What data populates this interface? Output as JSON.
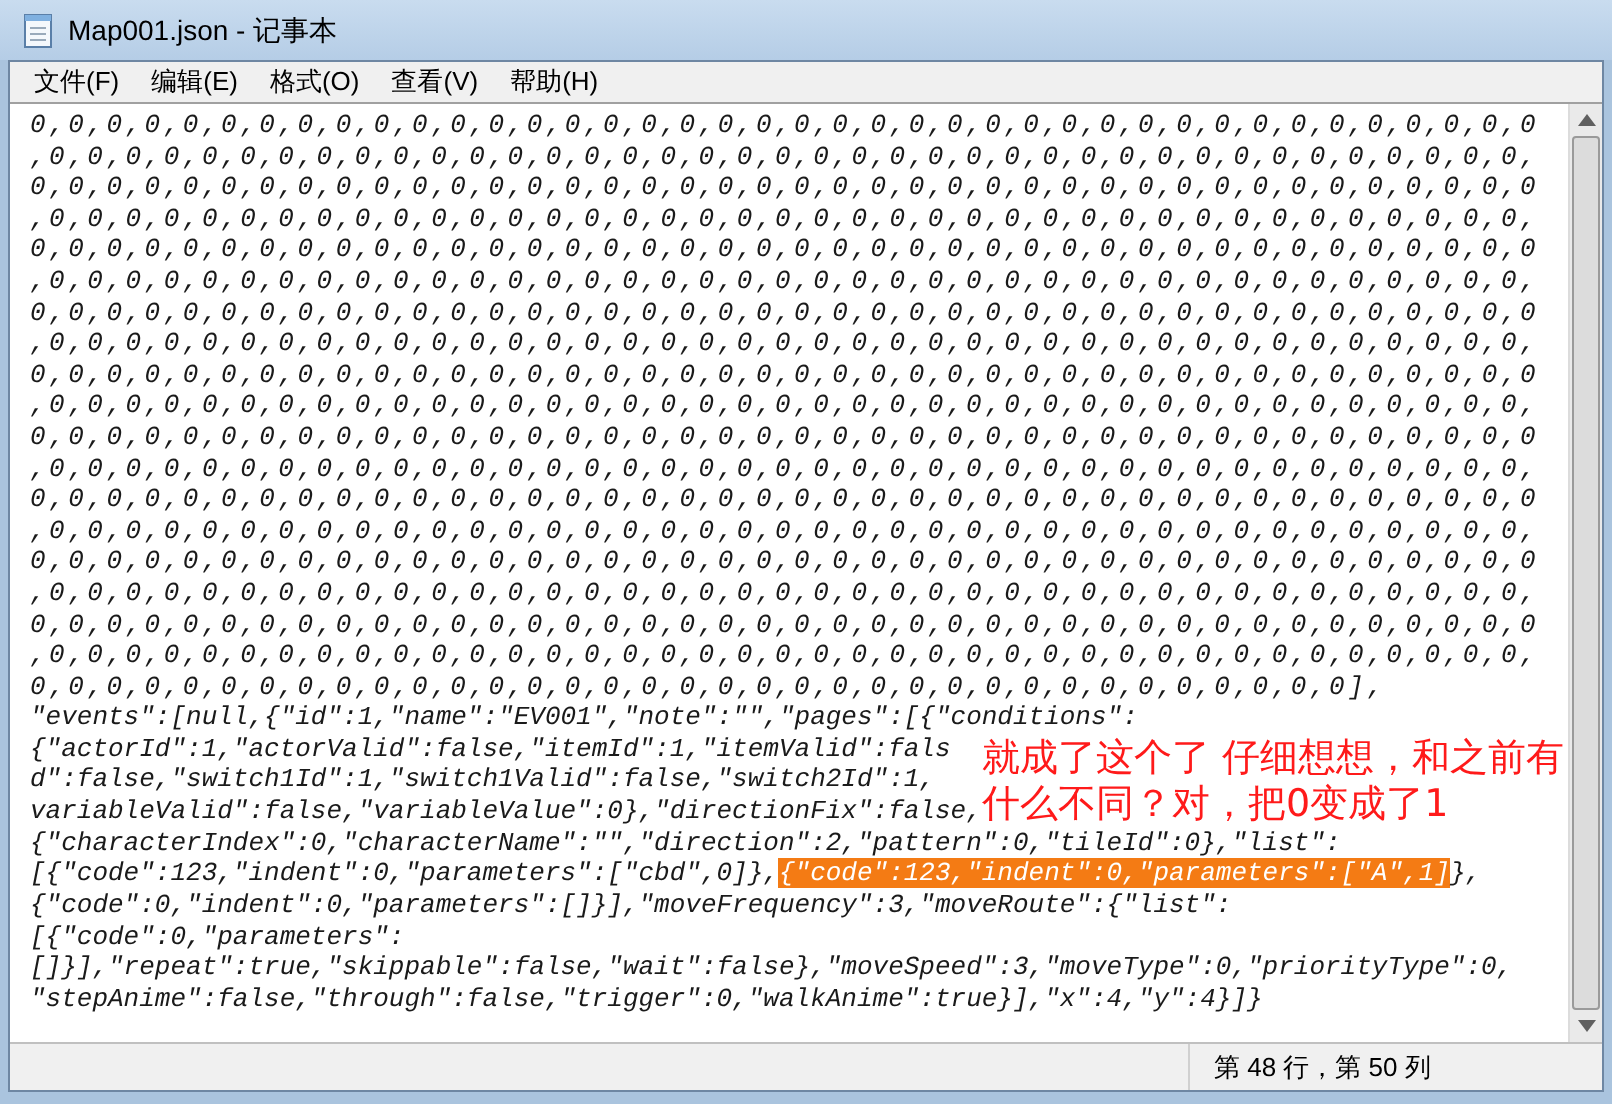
{
  "window": {
    "title": "Map001.json - 记事本"
  },
  "menu": [
    {
      "label": "文件(F)"
    },
    {
      "label": "编辑(E)"
    },
    {
      "label": "格式(O)"
    },
    {
      "label": "查看(V)"
    },
    {
      "label": "帮助(H)"
    }
  ],
  "editor": {
    "lines_top": [
      {
        "kind": "numbers",
        "segments": [
          {
            "text": "0,0,0,0,0,0,0,0,0,0,0,0,0,0,0,0,0,0,0,0,0,0,0,0,0,0,0,0,0,0,0,0,0,0,0,0,0,0,0,0",
            "selected": false
          }
        ]
      },
      {
        "kind": "numbers",
        "segments": [
          {
            "text": ",0,0,0,0,0,0,0,0,0,0,0,0,0,0,0,0,0,0,0,0,0,0,0,0,0,0,0,0,0,0,0,0,0,0,0,0,0,0,0,",
            "selected": false
          }
        ]
      },
      {
        "kind": "numbers",
        "segments": [
          {
            "text": "0,0,0,0,0,0,0,0,0,0,0,0,0,0,0,0,0,0,0,0,0,0,0,0,0,0,0,0,0,0,0,0,0,0,0,0,0,0,0,0",
            "selected": false
          }
        ]
      },
      {
        "kind": "numbers",
        "segments": [
          {
            "text": ",0,0,0,0,0,0,0,0,0,0,0,0,0,0,0,0,0,0,0,0,0,0,0,0,0,0,0,0,0,0,0,0,0,0,0,0,0,0,0,",
            "selected": false
          }
        ]
      },
      {
        "kind": "numbers",
        "segments": [
          {
            "text": "0,0,0,0,0,0,0,0,0,0,0,0,0,0,0,0,0,0,0,0,0,0,0,0,0,0,0,0,0,0,0,0,0,0,0,0,0,0,0,0",
            "selected": false
          }
        ]
      },
      {
        "kind": "numbers",
        "segments": [
          {
            "text": ",0,0,0,0,0,0,0,0,0,0,0,0,0,0,0,0,0,0,0,0,0,0,0,0,0,0,0,0,0,0,0,0,0,0,0,0,0,0,0,",
            "selected": false
          }
        ]
      },
      {
        "kind": "numbers",
        "segments": [
          {
            "text": "0,0,0,0,0,0,0,0,0,0,0,0,0,0,0,0,0,0,0,0,0,0,0,0,0,0,0,0,0,0,0,0,0,0,0,0,0,0,0,0",
            "selected": false
          }
        ]
      },
      {
        "kind": "numbers",
        "segments": [
          {
            "text": ",0,0,0,0,0,0,0,0,0,0,0,0,0,0,0,0,0,0,0,0,0,0,0,0,0,0,0,0,0,0,0,0,0,0,0,0,0,0,0,",
            "selected": false
          }
        ]
      },
      {
        "kind": "numbers",
        "segments": [
          {
            "text": "0,0,0,0,0,0,0,0,0,0,0,0,0,0,0,0,0,0,0,0,0,0,0,0,0,0,0,0,0,0,0,0,0,0,0,0,0,0,0,0",
            "selected": false
          }
        ]
      },
      {
        "kind": "numbers",
        "segments": [
          {
            "text": ",0,0,0,0,0,0,0,0,0,0,0,0,0,0,0,0,0,0,0,0,0,0,0,0,0,0,0,0,0,0,0,0,0,0,0,0,0,0,0,",
            "selected": false
          }
        ]
      },
      {
        "kind": "numbers",
        "segments": [
          {
            "text": "0,0,0,0,0,0,0,0,0,0,0,0,0,0,0,0,0,0,0,0,0,0,0,0,0,0,0,0,0,0,0,0,0,0,0,0,0,0,0,0",
            "selected": false
          }
        ]
      },
      {
        "kind": "numbers",
        "segments": [
          {
            "text": ",0,0,0,0,0,0,0,0,0,0,0,0,0,0,0,0,0,0,0,0,0,0,0,0,0,0,0,0,0,0,0,0,0,0,0,0,0,0,0,",
            "selected": false
          }
        ]
      },
      {
        "kind": "numbers",
        "segments": [
          {
            "text": "0,0,0,0,0,0,0,0,0,0,0,0,0,0,0,0,0,0,0,0,0,0,0,0,0,0,0,0,0,0,0,0,0,0,0,0,0,0,0,0",
            "selected": false
          }
        ]
      },
      {
        "kind": "numbers",
        "segments": [
          {
            "text": ",0,0,0,0,0,0,0,0,0,0,0,0,0,0,0,0,0,0,0,0,0,0,0,0,0,0,0,0,0,0,0,0,0,0,0,0,0,0,0,",
            "selected": false
          }
        ]
      },
      {
        "kind": "numbers",
        "segments": [
          {
            "text": "0,0,0,0,0,0,0,0,0,0,0,0,0,0,0,0,0,0,0,0,0,0,0,0,0,0,0,0,0,0,0,0,0,0,0,0,0,0,0,0",
            "selected": false
          }
        ]
      },
      {
        "kind": "numbers",
        "segments": [
          {
            "text": ",0,0,0,0,0,0,0,0,0,0,0,0,0,0,0,0,0,0,0,0,0,0,0,0,0,0,0,0,0,0,0,0,0,0,0,0,0,0,0,",
            "selected": false
          }
        ]
      },
      {
        "kind": "numbers",
        "segments": [
          {
            "text": "0,0,0,0,0,0,0,0,0,0,0,0,0,0,0,0,0,0,0,0,0,0,0,0,0,0,0,0,0,0,0,0,0,0,0,0,0,0,0,0",
            "selected": false
          }
        ]
      },
      {
        "kind": "numbers",
        "segments": [
          {
            "text": ",0,0,0,0,0,0,0,0,0,0,0,0,0,0,0,0,0,0,0,0,0,0,0,0,0,0,0,0,0,0,0,0,0,0,0,0,0,0,0,",
            "selected": false
          }
        ]
      },
      {
        "kind": "numbers",
        "segments": [
          {
            "text": "0,0,0,0,0,0,0,0,0,0,0,0,0,0,0,0,0,0,0,0,0,0,0,0,0,0,0,0,0,0,0,0,0,0,0],",
            "selected": false
          }
        ]
      },
      {
        "kind": "code",
        "segments": [
          {
            "text": "\"events\":[null,{\"id\":1,\"name\":\"EV001\",\"note\":\"\",\"pages\":[{\"conditions\":",
            "selected": false
          }
        ]
      }
    ],
    "annotated": {
      "lines": [
        {
          "kind": "code",
          "segments": [
            {
              "text": "{\"actorId\":1,\"actorValid\":false,\"itemId\":1,\"itemValid\":fals",
              "selected": false
            }
          ]
        },
        {
          "kind": "code",
          "segments": [
            {
              "text": "d\":false,\"switch1Id\":1,\"switch1Valid\":false,\"switch2Id\":1,",
              "selected": false
            }
          ]
        },
        {
          "kind": "code",
          "segments": [
            {
              "text": "variableValid\":false,\"variableValue\":0},\"directionFix\":false,",
              "selected": false
            }
          ]
        }
      ],
      "note": [
        "就成了这个了 仔细想想，和之前有",
        "什么不同？对，把0变成了1"
      ]
    },
    "lines_bottom": [
      {
        "kind": "code",
        "segments": [
          {
            "text": "{\"characterIndex\":0,\"characterName\":\"\",\"direction\":2,\"pattern\":0,\"tileId\":0},\"list\":",
            "selected": false
          }
        ]
      },
      {
        "kind": "code",
        "segments": [
          {
            "text": "[{\"code\":123,\"indent\":0,\"parameters\":[\"cbd\",0]},",
            "selected": false
          },
          {
            "text": "{\"code\":123,\"indent\":0,\"parameters\":[\"A\",1]",
            "selected": true
          },
          {
            "text": "},",
            "selected": false
          }
        ]
      },
      {
        "kind": "code",
        "segments": [
          {
            "text": "{\"code\":0,\"indent\":0,\"parameters\":[]}],\"moveFrequency\":3,\"moveRoute\":{\"list\":",
            "selected": false
          }
        ]
      },
      {
        "kind": "code",
        "segments": [
          {
            "text": "[{\"code\":0,\"parameters\":",
            "selected": false
          }
        ]
      },
      {
        "kind": "code",
        "segments": [
          {
            "text": "[]}],\"repeat\":true,\"skippable\":false,\"wait\":false},\"moveSpeed\":3,\"moveType\":0,\"priorityType\":0,",
            "selected": false
          }
        ]
      },
      {
        "kind": "code",
        "segments": [
          {
            "text": "\"stepAnime\":false,\"through\":false,\"trigger\":0,\"walkAnime\":true}],\"x\":4,\"y\":4}]}",
            "selected": false
          }
        ]
      }
    ]
  },
  "status_bar": {
    "position": "第 48 行，第 50 列"
  }
}
